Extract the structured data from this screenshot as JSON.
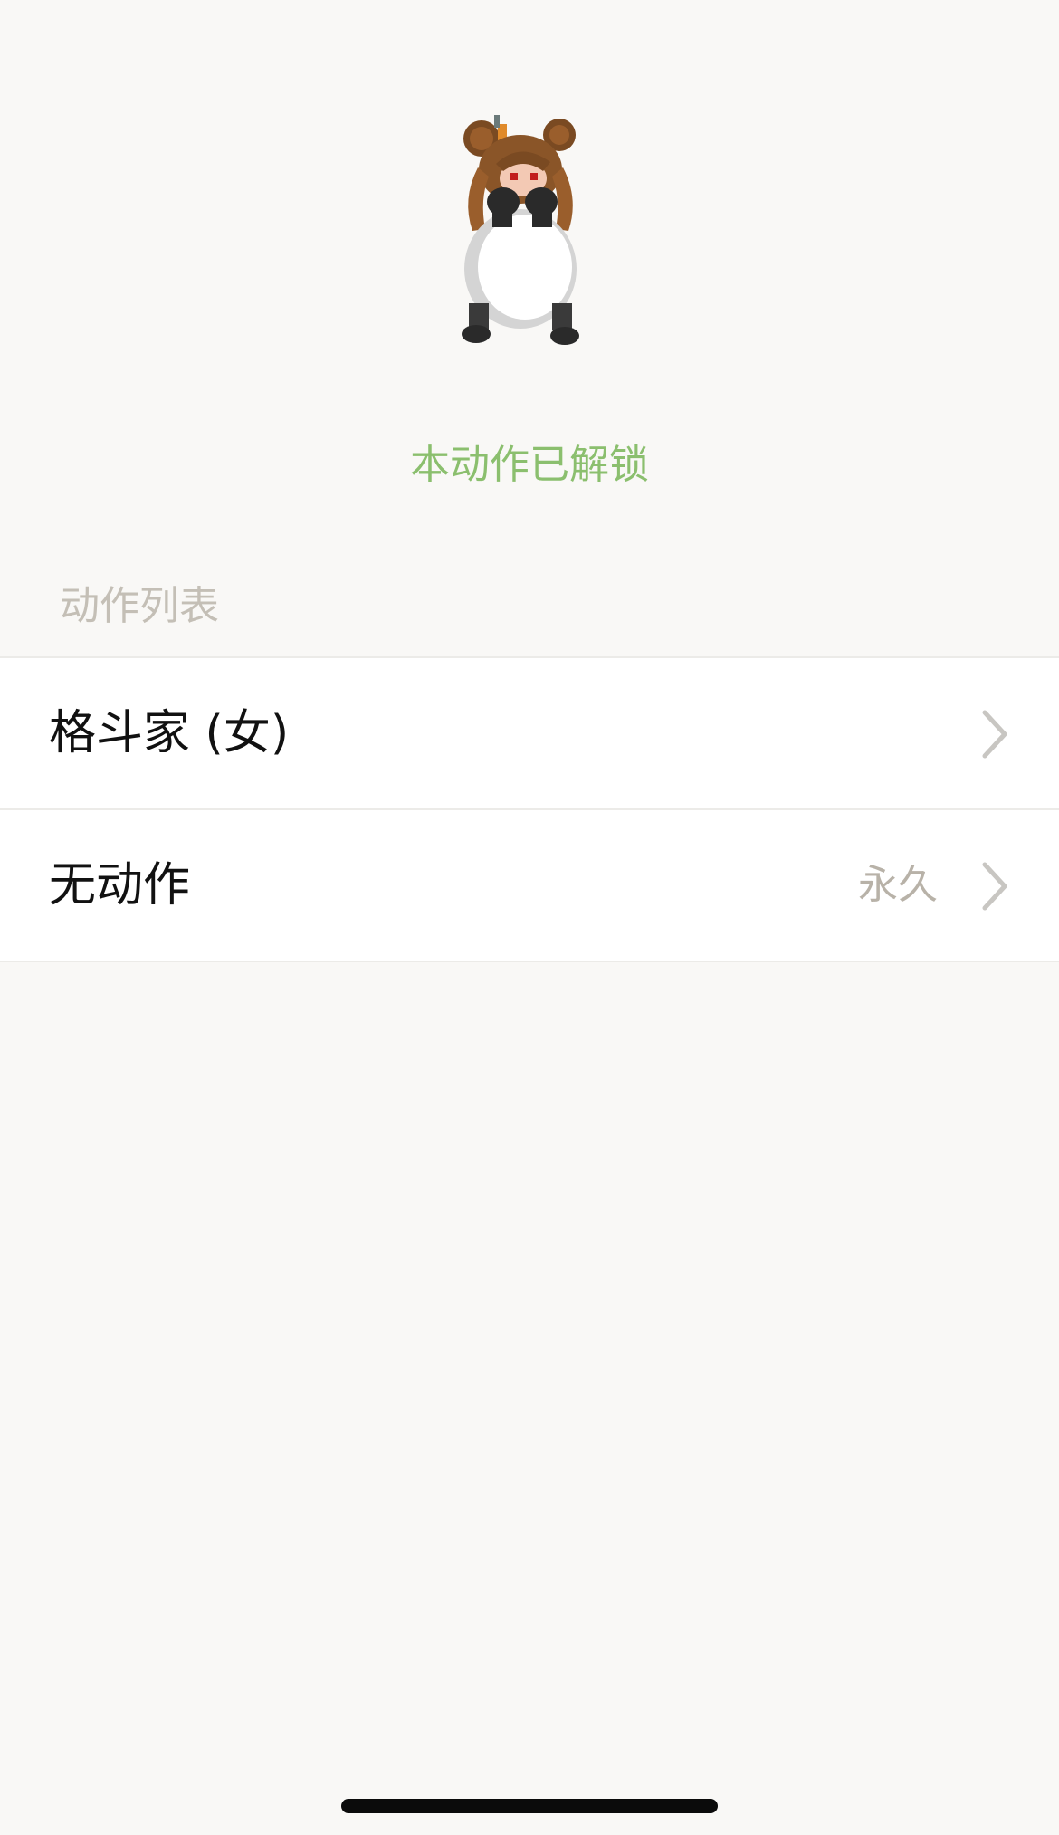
{
  "status": {
    "unlock_text": "本动作已解锁",
    "color": "#8bbf6e"
  },
  "section": {
    "header": "动作列表"
  },
  "actions": [
    {
      "title": "格斗家 (女)",
      "value": ""
    },
    {
      "title": "无动作",
      "value": "永久"
    }
  ],
  "icons": {
    "sprite": "pixel-character-icon",
    "chevron": "chevron-right-icon"
  }
}
